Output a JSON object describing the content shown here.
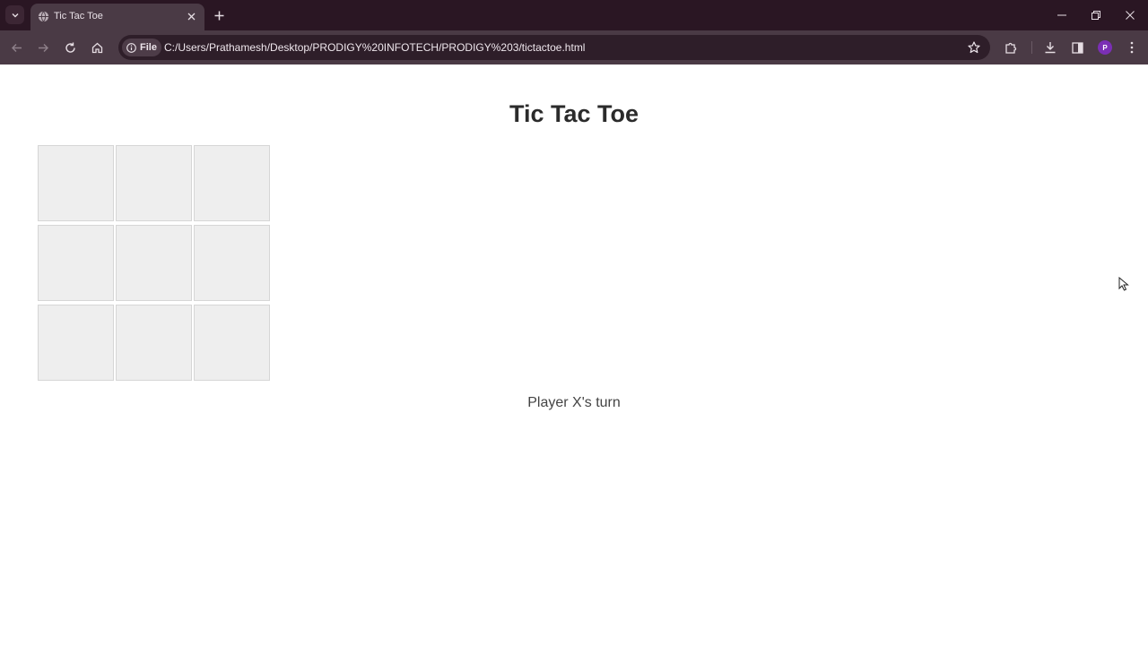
{
  "browser": {
    "tab_title": "Tic Tac Toe",
    "site_chip_label": "File",
    "url": "C:/Users/Prathamesh/Desktop/PRODIGY%20INFOTECH/PRODIGY%203/tictactoe.html",
    "profile_initial": "P",
    "profile_color": "#7b2fb5",
    "icons": [
      "tab-search-icon",
      "globe-icon",
      "close-icon",
      "plus-icon",
      "minimize-icon",
      "restore-icon",
      "back-arrow-icon",
      "forward-arrow-icon",
      "reload-icon",
      "home-icon",
      "info-icon",
      "star-icon",
      "extensions-icon",
      "download-icon",
      "side-panel-icon",
      "kebab-menu-icon"
    ]
  },
  "game": {
    "title": "Tic Tac Toe",
    "board": [
      "",
      "",
      "",
      "",
      "",
      "",
      "",
      "",
      ""
    ],
    "status": "Player X's turn"
  }
}
